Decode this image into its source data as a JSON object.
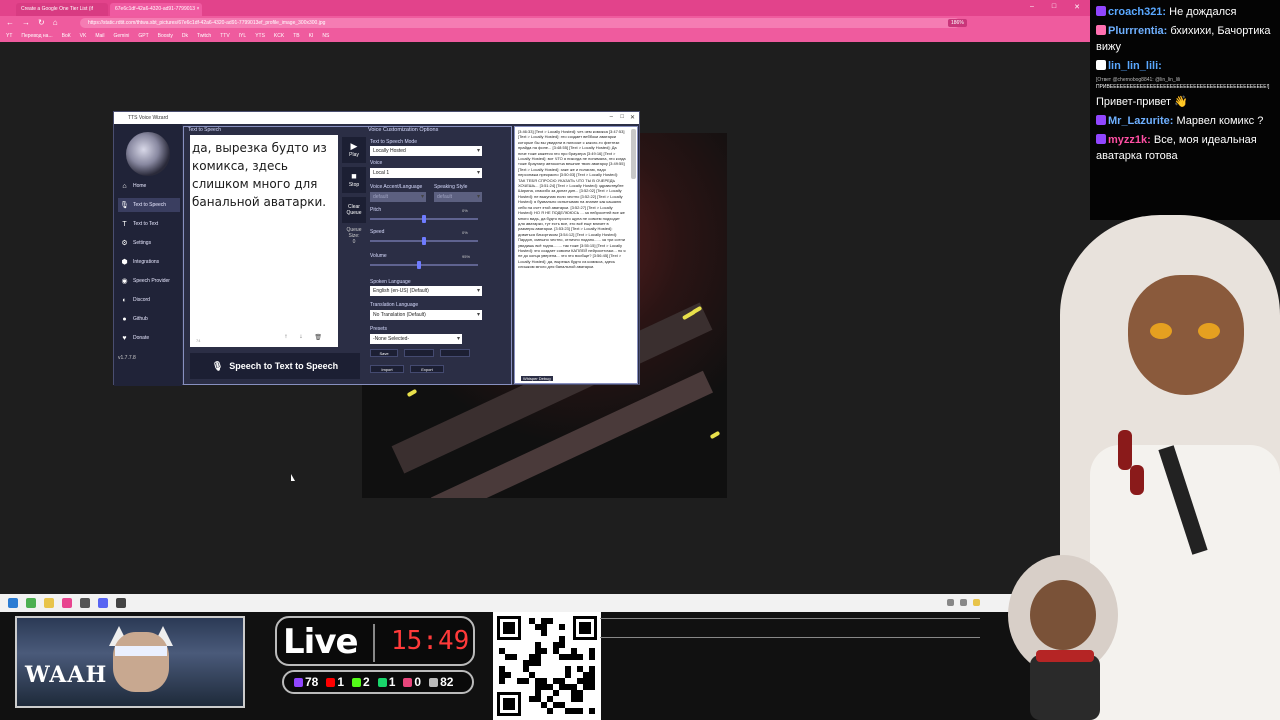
{
  "browser": {
    "tabs": [
      {
        "title": "Create a Google One Tier List (if"
      },
      {
        "title": "67e6c1df-42a6-4320-ad91-7799013 ×"
      }
    ],
    "url": "https://static.rdtit.com/thtwa.sbt_pictures/67e6c1df-42a6-4320-ad91-7799013ef_profile_image_300x300.jpg",
    "zoom": "186%",
    "bookmarks": [
      "YT",
      "Перевод на...",
      "ВоК",
      "VK",
      "Mail",
      "Gemini",
      "GPT",
      "Boosty",
      "Dk",
      "Twitch",
      "TTV",
      "IYL",
      "YTS",
      "KCK",
      "TB",
      "KI",
      "NS"
    ]
  },
  "tts": {
    "window_title": "TTS Voice Wizard",
    "nav": [
      {
        "label": "Home",
        "icon": "home-icon"
      },
      {
        "label": "Text to Speech",
        "icon": "microphone-icon"
      },
      {
        "label": "Text to Text",
        "icon": "text-icon"
      },
      {
        "label": "Settings",
        "icon": "gear-icon"
      },
      {
        "label": "Integrations",
        "icon": "integrations-icon"
      },
      {
        "label": "Speech Provider",
        "icon": "speech-provider-icon"
      },
      {
        "label": "Discord",
        "icon": "discord-icon"
      },
      {
        "label": "Github",
        "icon": "github-icon"
      },
      {
        "label": "Donate",
        "icon": "heart-icon"
      }
    ],
    "version": "v1.7.7.8",
    "section_title": "Text to Speech",
    "text_content": "да, вырезка будто из комикса, здесь слишком много для банальной аватарки.",
    "char_count": "74",
    "play_label": "Play",
    "stop_label": "Stop",
    "clear_label": "Clear Queue",
    "queue_label": "Queue Size:",
    "queue_size": "0",
    "stt_button": "Speech to Text to Speech",
    "voice": {
      "title": "Voice Customization Options",
      "mode_label": "Text to Speech Mode",
      "mode_value": "Locally Hosted",
      "voice_label": "Voice",
      "voice_value": "Local 1",
      "accent_label": "Voice Accent/Language",
      "accent_value": "default",
      "style_label": "Speaking Style",
      "style_value": "default",
      "pitch_label": "Pitch",
      "pitch_value": "0%",
      "pitch_level": 0.5,
      "speed_label": "Speed",
      "speed_value": "0%",
      "speed_level": 0.5,
      "volume_label": "Volume",
      "volume_value": "95%",
      "volume_level": 0.45,
      "spoken_label": "Spoken Language",
      "spoken_value": "English (en-US) (Default)",
      "translation_label": "Translation Language",
      "translation_value": "No Translation (Default)",
      "presets_label": "Presets",
      "presets_value": "-None Selected-",
      "save_label": "Save",
      "import_label": "Import",
      "export_label": "Export"
    },
    "log_title": "Log",
    "log_text": "[3:46:33] [Text > Locally Hosted]: чет-чем комикса [3:47:53] [Text > Locally Hosted]: это создает веббоки аватарки которые бы вы увидели в пилоске с какого-то фэнтези прайда на фоне... [3:48:55] [Text > Locally Hosted]: Да ниче тоже кажется это про браузера [3:49:16] [Text > Locally Hosted]: вот ЧТО я никогда не понимала, это когда тоже брауэзер автоконча вешние твою аватарку [3:49:55] [Text > Locally Hosted]: хаке же и полагаю, надо персонажа прекрасно [3:50:03] [Text > Locally Hosted]: ТАК ТЕБЯ СПРОСЮ УКАЗАТЬ ЧТО ТЫ В ОЧЕРЕДЬ ХОЧЕШЬ... [3:51:24] [Text > Locally Hosted]: здравствуйте Ширина, спасибо за донат дин... [3:52:02] [Text > Locally Hosted]: не выкупаю если честно [3:52:22] [Text > Locally Hosted]: я буквально испытываю на знание как кашалю себя на счет этой аватарки. [3:52:27] [Text > Locally Hosted]: НО Я НЕ ПОДЕЛЮЮСЬ ... за нейросетей все же много видь, да будто просто щупа не совсем подходит для аватарки, тут есть все, это всё еще влияет в размеры аватарки. [3:53:23] [Text > Locally Hosted]: дивиться бачортиком [3:54:12] [Text > Locally Hosted]: Пардон, смешно честно, отлично подано...... за три сотни увидишь всё годна........ так тоже [3:55:15] [Text > Locally Hosted]: это создает совсем КАПЛЕЙ нейросеточки... но я не до конца уверена... что это вообще? [3:56:45] [Text > Locally Hosted]: да, вырезка будто из комикса, здесь слишком много для банальной аватарки.",
    "log_footer": "Whisper Debug"
  },
  "chat": [
    {
      "user": "croach321:",
      "color": "#5aa8ff",
      "message": "Не дождался"
    },
    {
      "user": "Plurrrentia:",
      "color": "#6fb0ff",
      "message": "бхихихи, Бачортика вижу"
    },
    {
      "user": "lin_lin_lili:",
      "color": "#5aa8ff",
      "message": "",
      "reply_hint": "[Ответ @chernobog8841: @lin_lin_lili",
      "reply_body": "ПРИВЕЕЕЕЕЕЕЕЕЕЕЕЕЕЕЕЕЕЕЕЕЕЕЕЕЕЕЕЕЕЕЕЕЕЕЕЕЕЕЕЕЕЕЕЕЕЕ!]"
    },
    {
      "user": "",
      "color": "#ffffff",
      "message": "Привет-привет 👋"
    },
    {
      "user": "Mr_Lazurite:",
      "color": "#6fb0ff",
      "message": "Марвел комикс ?"
    },
    {
      "user": "myzz1k:",
      "color": "#ff4fa3",
      "message": "Все, моя идеальная аватарка готова"
    }
  ],
  "overlay": {
    "cam_text": "WAAH",
    "live_label": "Live",
    "live_time": "15:49",
    "stats": [
      {
        "icon": "twitch-icon",
        "color": "#9146ff",
        "value": "78"
      },
      {
        "icon": "youtube-icon",
        "color": "#ff0000",
        "value": "1"
      },
      {
        "icon": "kick-icon",
        "color": "#53fc18",
        "value": "2"
      },
      {
        "icon": "trovo-icon",
        "color": "#19d66b",
        "value": "1"
      },
      {
        "icon": "vk-icon",
        "color": "#e8467c",
        "value": "0"
      },
      {
        "icon": "viewers-icon",
        "color": "#bbbbbb",
        "value": "82"
      }
    ]
  },
  "colors": {
    "browser_chrome": "#e8458f",
    "tts_bg": "#2b2e45",
    "chat_bg": "#000000",
    "live_time": "#ff3a3a"
  }
}
